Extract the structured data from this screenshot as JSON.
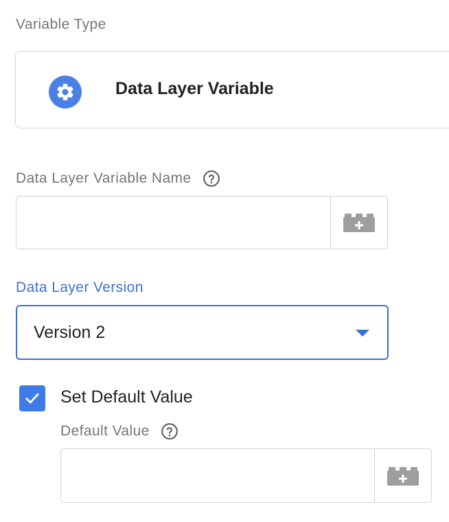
{
  "variable_type": {
    "section_label": "Variable Type",
    "selected_type": "Data Layer Variable",
    "icon": "gear-icon",
    "icon_color": "#4a7fe6"
  },
  "variable_name": {
    "label": "Data Layer Variable Name",
    "help_icon": "help-circle-icon",
    "value": "",
    "picker_icon": "variable-brick-icon"
  },
  "version": {
    "label": "Data Layer Version",
    "selected_value": "Version 2",
    "accent_color": "#3d6fd6"
  },
  "default_value": {
    "checkbox_label": "Set Default Value",
    "checked": true,
    "field_label": "Default Value",
    "help_icon": "help-circle-icon",
    "value": "",
    "picker_icon": "variable-brick-icon"
  }
}
